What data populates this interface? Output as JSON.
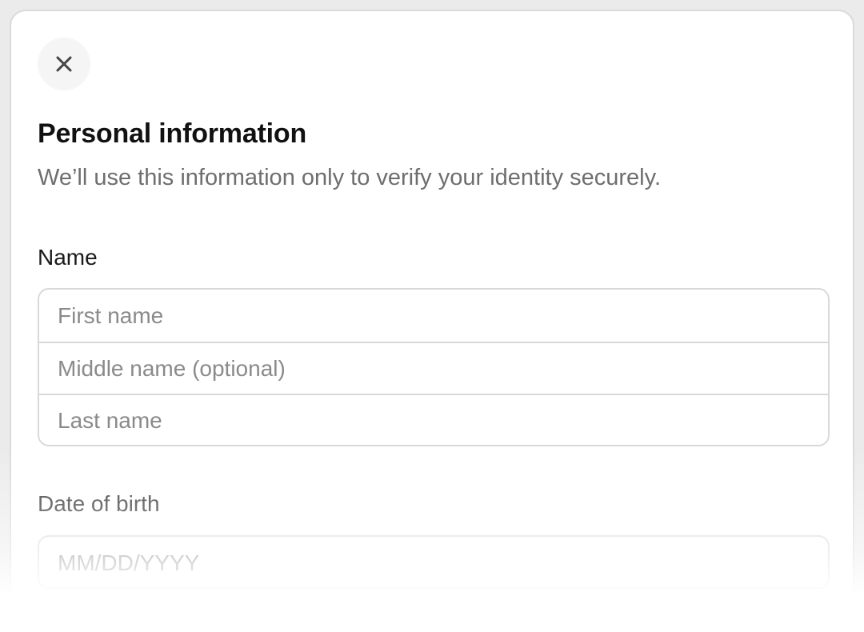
{
  "dialog": {
    "close_icon": "close-icon",
    "title": "Personal information",
    "subtitle": "We’ll use this information only to verify your identity securely."
  },
  "name_section": {
    "label": "Name",
    "first_name": {
      "placeholder": "First name",
      "value": ""
    },
    "middle_name": {
      "placeholder": "Middle name (optional)",
      "value": ""
    },
    "last_name": {
      "placeholder": "Last name",
      "value": ""
    }
  },
  "dob_section": {
    "label": "Date of birth",
    "date": {
      "placeholder": "MM/DD/YYYY",
      "value": ""
    }
  },
  "colors": {
    "title": "#111111",
    "subtitle": "#6e6e6e",
    "placeholder": "#8a8a8a",
    "border": "#d9d9d9"
  }
}
